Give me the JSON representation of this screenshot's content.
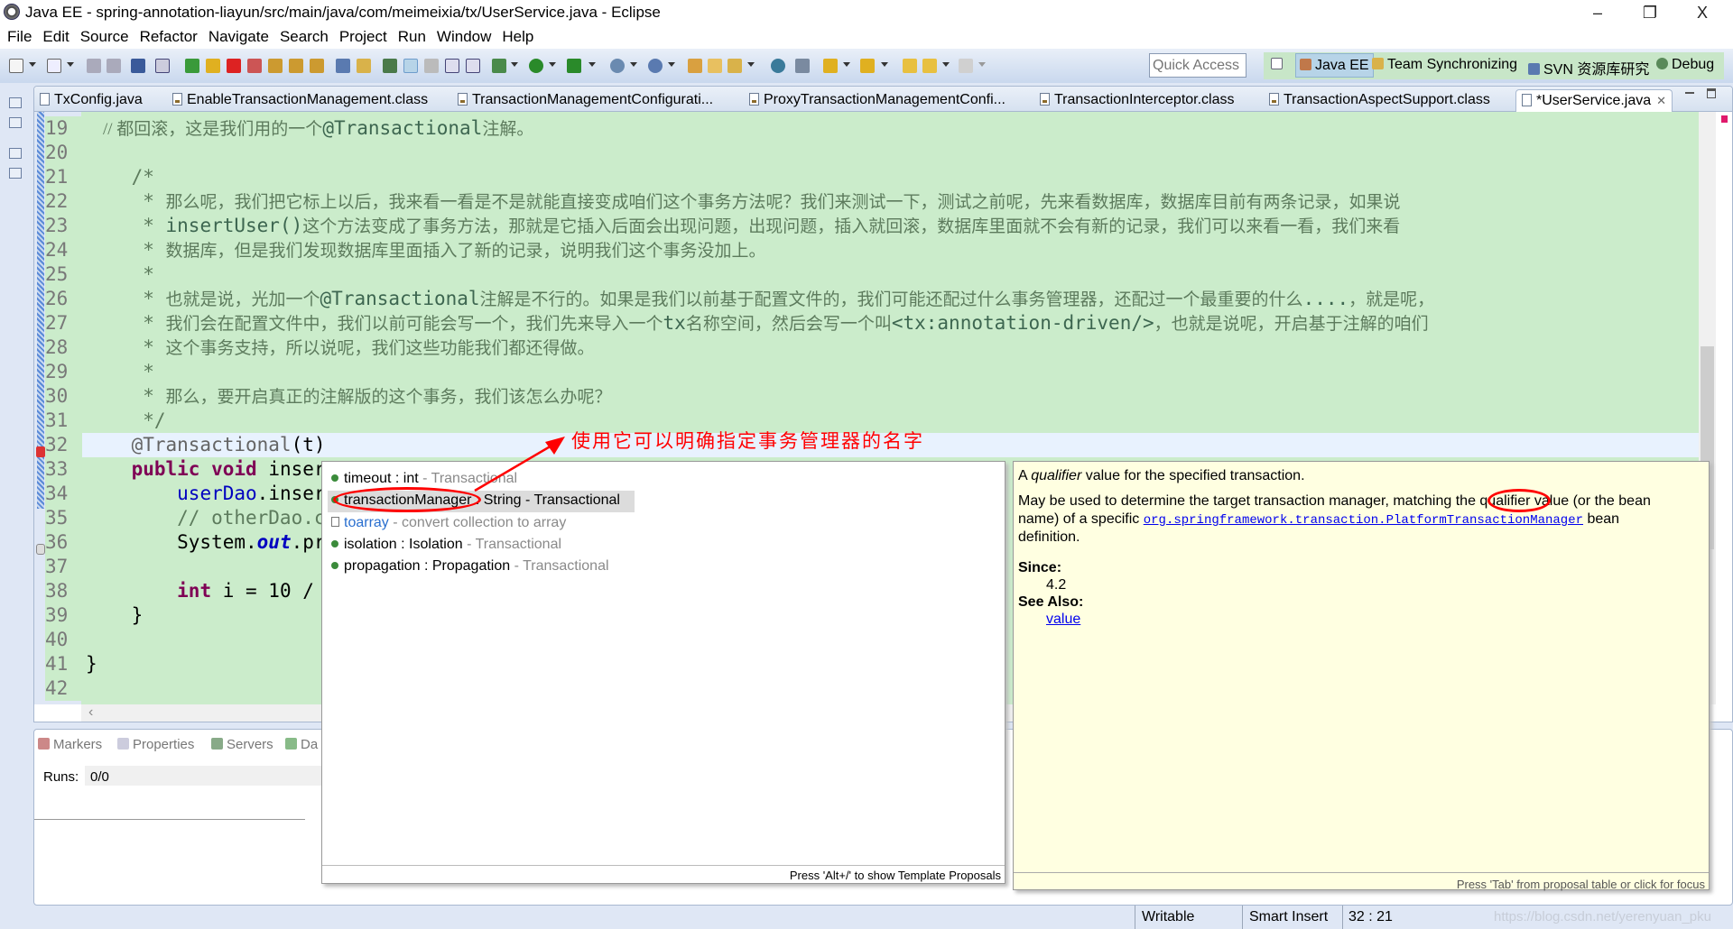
{
  "window": {
    "title": "Java EE - spring-annotation-liayun/src/main/java/com/meimeixia/tx/UserService.java - Eclipse",
    "minimize": "–",
    "restore": "❐",
    "close": "X"
  },
  "menu": [
    "File",
    "Edit",
    "Source",
    "Refactor",
    "Navigate",
    "Search",
    "Project",
    "Run",
    "Window",
    "Help"
  ],
  "toolbar": {
    "quick_access_placeholder": "Quick Access"
  },
  "perspectives": [
    {
      "label": "Java EE",
      "active": true,
      "color": "#c0784a"
    },
    {
      "label": "Team Synchronizing",
      "active": false,
      "color": "#d9b24a"
    },
    {
      "label": "SVN 资源库研究",
      "active": false,
      "color": "#5a7ab0"
    },
    {
      "label": "Debug",
      "active": false,
      "color": "#5a8a5a"
    }
  ],
  "editor_tabs": [
    {
      "label": "TxConfig.java",
      "type": "java"
    },
    {
      "label": "EnableTransactionManagement.class",
      "type": "class"
    },
    {
      "label": "TransactionManagementConfigurati...",
      "type": "class"
    },
    {
      "label": "ProxyTransactionManagementConfi...",
      "type": "class"
    },
    {
      "label": "TransactionInterceptor.class",
      "type": "class"
    },
    {
      "label": "TransactionAspectSupport.class",
      "type": "class"
    },
    {
      "label": "*UserService.java",
      "type": "java",
      "active": true
    }
  ],
  "code_lines": [
    {
      "n": "19",
      "segs": [
        [
          "c",
          "    // 都回滚，这是我们用的一个"
        ],
        [
          "cc",
          "@Transactional"
        ],
        [
          "c",
          "注解。"
        ]
      ]
    },
    {
      "n": "20",
      "segs": []
    },
    {
      "n": "21",
      "segs": [
        [
          "cm",
          "    /*"
        ]
      ]
    },
    {
      "n": "22",
      "segs": [
        [
          "cm",
          "     * "
        ],
        [
          "c",
          "那么呢，我们把它标上以后，我来看一看是不是就能直接变成咱们这个事务方法呢？我们来测试一下，测试之前呢，先来看数据库，数据库目前有两条记录，如果说"
        ]
      ]
    },
    {
      "n": "23",
      "segs": [
        [
          "cm",
          "     * "
        ],
        [
          "cc",
          "insertUser()"
        ],
        [
          "c",
          "这个方法变成了事务方法，那就是它插入后面会出现问题，出现问题，插入就回滚，数据库里面就不会有新的记录，我们可以来看一看，我们来看"
        ]
      ]
    },
    {
      "n": "24",
      "segs": [
        [
          "cm",
          "     * "
        ],
        [
          "c",
          "数据库，但是我们发现数据库里面插入了新的记录，说明我们这个事务没加上。"
        ]
      ]
    },
    {
      "n": "25",
      "segs": [
        [
          "cm",
          "     *"
        ]
      ]
    },
    {
      "n": "26",
      "segs": [
        [
          "cm",
          "     * "
        ],
        [
          "c",
          "也就是说，光加一个"
        ],
        [
          "cc",
          "@Transactional"
        ],
        [
          "c",
          "注解是不行的。如果是我们以前基于配置文件的，我们可能还配过什么事务管理器，还配过一个最重要的什么"
        ],
        [
          "cc",
          "...."
        ],
        [
          "c",
          "，就是呢，"
        ]
      ]
    },
    {
      "n": "27",
      "segs": [
        [
          "cm",
          "     * "
        ],
        [
          "c",
          "我们会在配置文件中，我们以前可能会写一个，我们先来导入一个"
        ],
        [
          "cc",
          "tx"
        ],
        [
          "c",
          "名称空间，然后会写一个叫"
        ],
        [
          "cc",
          "<tx:annotation-driven/>"
        ],
        [
          "c",
          "，也就是说呢，开启基于注解的咱们"
        ]
      ]
    },
    {
      "n": "28",
      "segs": [
        [
          "cm",
          "     * "
        ],
        [
          "c",
          "这个事务支持，所以说呢，我们这些功能我们都还得做。"
        ]
      ]
    },
    {
      "n": "29",
      "segs": [
        [
          "cm",
          "     *"
        ]
      ]
    },
    {
      "n": "30",
      "segs": [
        [
          "cm",
          "     * "
        ],
        [
          "c",
          "那么，要开启真正的注解版的这个事务，我们该怎么办呢？"
        ]
      ]
    },
    {
      "n": "31",
      "segs": [
        [
          "cm",
          "     */"
        ]
      ]
    },
    {
      "n": "32",
      "segs": [
        [
          "a",
          "    @Transactional"
        ],
        [
          "p",
          "(t)"
        ]
      ],
      "current": true
    },
    {
      "n": "33",
      "segs": [
        [
          "p",
          "    "
        ],
        [
          "k",
          "public"
        ],
        [
          "p",
          " "
        ],
        [
          "k",
          "void"
        ],
        [
          "p",
          " inser"
        ]
      ]
    },
    {
      "n": "34",
      "segs": [
        [
          "p",
          "        "
        ],
        [
          "f",
          "userDao"
        ],
        [
          "p",
          ".inser"
        ]
      ]
    },
    {
      "n": "35",
      "segs": [
        [
          "cm",
          "        // otherDao.c"
        ]
      ]
    },
    {
      "n": "36",
      "segs": [
        [
          "p",
          "        System."
        ],
        [
          "fi",
          "out"
        ],
        [
          "p",
          ".pr"
        ]
      ]
    },
    {
      "n": "37",
      "segs": []
    },
    {
      "n": "38",
      "segs": [
        [
          "p",
          "        "
        ],
        [
          "k",
          "int"
        ],
        [
          "p",
          " i = 10 /"
        ]
      ]
    },
    {
      "n": "39",
      "segs": [
        [
          "p",
          "    }"
        ]
      ]
    },
    {
      "n": "40",
      "segs": []
    },
    {
      "n": "41",
      "segs": [
        [
          "p",
          "}"
        ]
      ]
    },
    {
      "n": "42",
      "segs": []
    }
  ],
  "completion": {
    "items": [
      {
        "name": "timeout",
        "type": " : int",
        "source": " - Transactional",
        "kind": "method"
      },
      {
        "name": "transactionManager",
        "type": " : String - Transactional",
        "source": "",
        "kind": "method",
        "selected": true
      },
      {
        "name": "toarray",
        "type": "",
        "source": " - convert collection to array",
        "kind": "template"
      },
      {
        "name": "isolation",
        "type": " : Isolation",
        "source": " - Transactional",
        "kind": "method"
      },
      {
        "name": "propagation",
        "type": " : Propagation",
        "source": " - Transactional",
        "kind": "method"
      }
    ],
    "footer": "Press 'Alt+/' to show Template Proposals"
  },
  "doc": {
    "line1_a": "A ",
    "line1_em": "qualifier",
    "line1_b": " value for the specified transaction.",
    "line2": "May be used to determine the target transaction manager, matching the qualifier value (or the bean",
    "line3_a": "name) of a specific ",
    "line3_link": "org.springframework.transaction.PlatformTransactionManager",
    "line3_b": " bean",
    "line4": "definition.",
    "since_label": "Since:",
    "since_value": "4.2",
    "see_also_label": "See Also:",
    "see_also_link": "value",
    "footer": "Press 'Tab' from proposal table or click for focus"
  },
  "annotation": {
    "text": "使用它可以明确指定事务管理器的名字",
    "color": "#ff0000"
  },
  "bottom_panel": {
    "tabs": [
      "Markers",
      "Properties",
      "Servers",
      "Da"
    ],
    "runs_label": "Runs:",
    "runs_value": "0/0"
  },
  "status": {
    "writable": "Writable",
    "insert_mode": "Smart Insert",
    "position": "32 : 21",
    "watermark": "https://blog.csdn.net/yerenyuan_pku"
  }
}
